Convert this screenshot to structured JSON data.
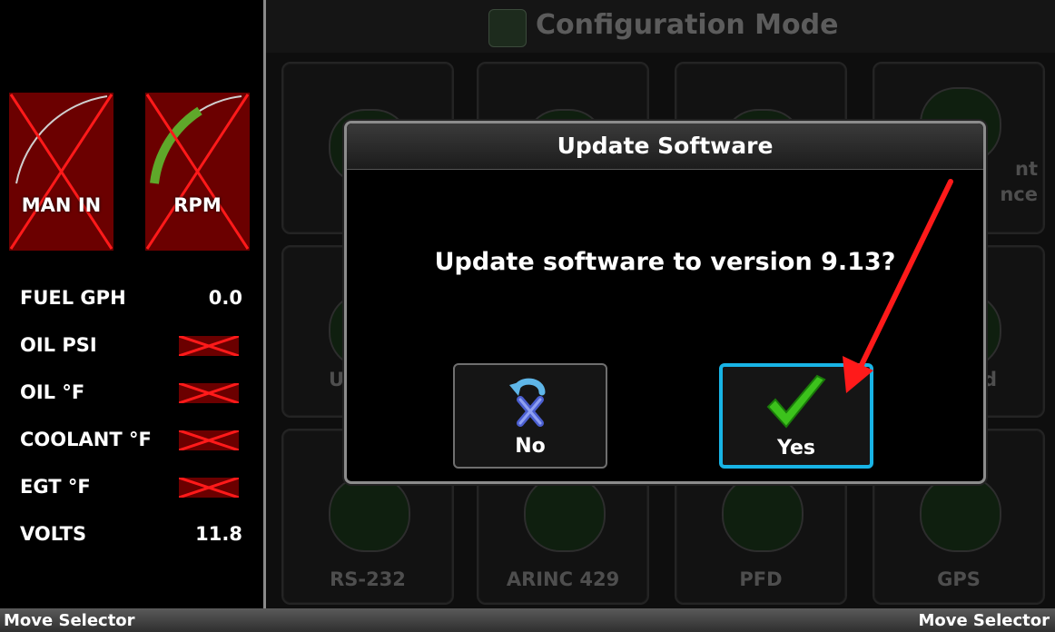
{
  "gauges": {
    "manifold": {
      "label": "MAN IN"
    },
    "rpm": {
      "label": "RPM"
    }
  },
  "engine_rows": [
    {
      "label": "FUEL GPH",
      "value": "0.0"
    },
    {
      "label": "OIL PSI",
      "value": null
    },
    {
      "label": "OIL °F",
      "value": null
    },
    {
      "label": "COOLANT °F",
      "value": null
    },
    {
      "label": "EGT °F",
      "value": null
    },
    {
      "label": "VOLTS",
      "value": "11.8"
    }
  ],
  "config": {
    "title": "Configuration Mode",
    "tiles_top_right_partial": [
      "nt",
      "nce"
    ],
    "tile_mid_left_partial": "U",
    "tile_mid_right_partial": "d",
    "bottom_tiles": [
      "RS-232",
      "ARINC 429",
      "PFD",
      "GPS"
    ]
  },
  "dialog": {
    "title": "Update Software",
    "message": "Update software to version 9.13?",
    "no_label": "No",
    "yes_label": "Yes"
  },
  "softkeys": {
    "left": "Move Selector",
    "right": "Move Selector"
  },
  "colors": {
    "selection": "#18b4e6",
    "failed_gauge": "#6b0000",
    "fail_x": "#ff1a1a",
    "annotation_arrow": "#ff1a1a"
  }
}
